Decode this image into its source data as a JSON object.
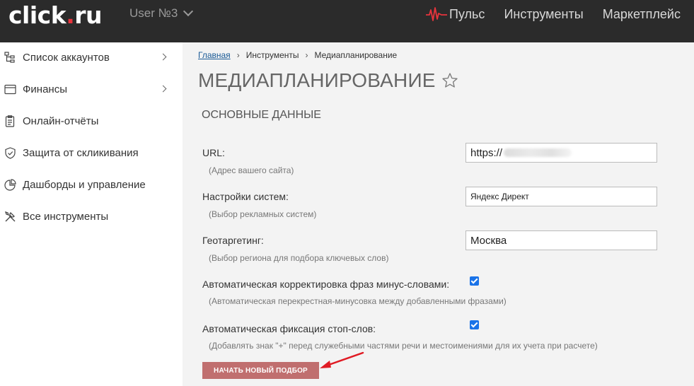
{
  "header": {
    "logo_text": "click",
    "logo_dot": ".",
    "logo_suffix": "ru",
    "user_label": "User №3",
    "nav": [
      "Пульс",
      "Инструменты",
      "Маркетплейс"
    ]
  },
  "sidebar": {
    "items": [
      {
        "label": "Список аккаунтов",
        "icon": "accounts-tree-icon",
        "has_arrow": true
      },
      {
        "label": "Финансы",
        "icon": "wallet-icon",
        "has_arrow": true
      },
      {
        "label": "Онлайн-отчёты",
        "icon": "report-icon",
        "has_arrow": false
      },
      {
        "label": "Защита от скликивания",
        "icon": "shield-icon",
        "has_arrow": false
      },
      {
        "label": "Дашборды и управление",
        "icon": "dashboard-icon",
        "has_arrow": false
      },
      {
        "label": "Все инструменты",
        "icon": "tools-icon",
        "has_arrow": false
      }
    ]
  },
  "breadcrumb": {
    "home": "Главная",
    "tools": "Инструменты",
    "current": "Медиапланирование",
    "separator": "›"
  },
  "page": {
    "title": "МЕДИАПЛАНИРОВАНИЕ",
    "section_title": "ОСНОВНЫЕ ДАННЫЕ"
  },
  "form": {
    "url": {
      "label": "URL:",
      "hint": "(Адрес вашего сайта)",
      "value": "https://"
    },
    "systems": {
      "label": "Настройки систем:",
      "hint": "(Выбор рекламных систем)",
      "value": "Яндекс Директ"
    },
    "geo": {
      "label": "Геотаргетинг:",
      "hint": "(Выбор региона для подбора ключевых слов)",
      "value": "Москва"
    },
    "auto_minus": {
      "label": "Автоматическая корректировка фраз минус-словами:",
      "hint": "(Автоматическая перекрестная-минусовка между добавленными фразами)",
      "checked": true
    },
    "auto_stop": {
      "label": "Автоматическая фиксация стоп-слов:",
      "hint": "(Добавлять знак \"+\" перед служебными частями речи и местоимениями для их учета при расчете)",
      "checked": true
    }
  },
  "start_button": "НАЧАТЬ НОВЫЙ ПОДБОР",
  "colors": {
    "topbar": "#2b2b2b",
    "accent_red": "#e8343c",
    "button": "#c06f6f",
    "checkbox": "#1a73e8",
    "main_bg": "#f3f3f3"
  }
}
